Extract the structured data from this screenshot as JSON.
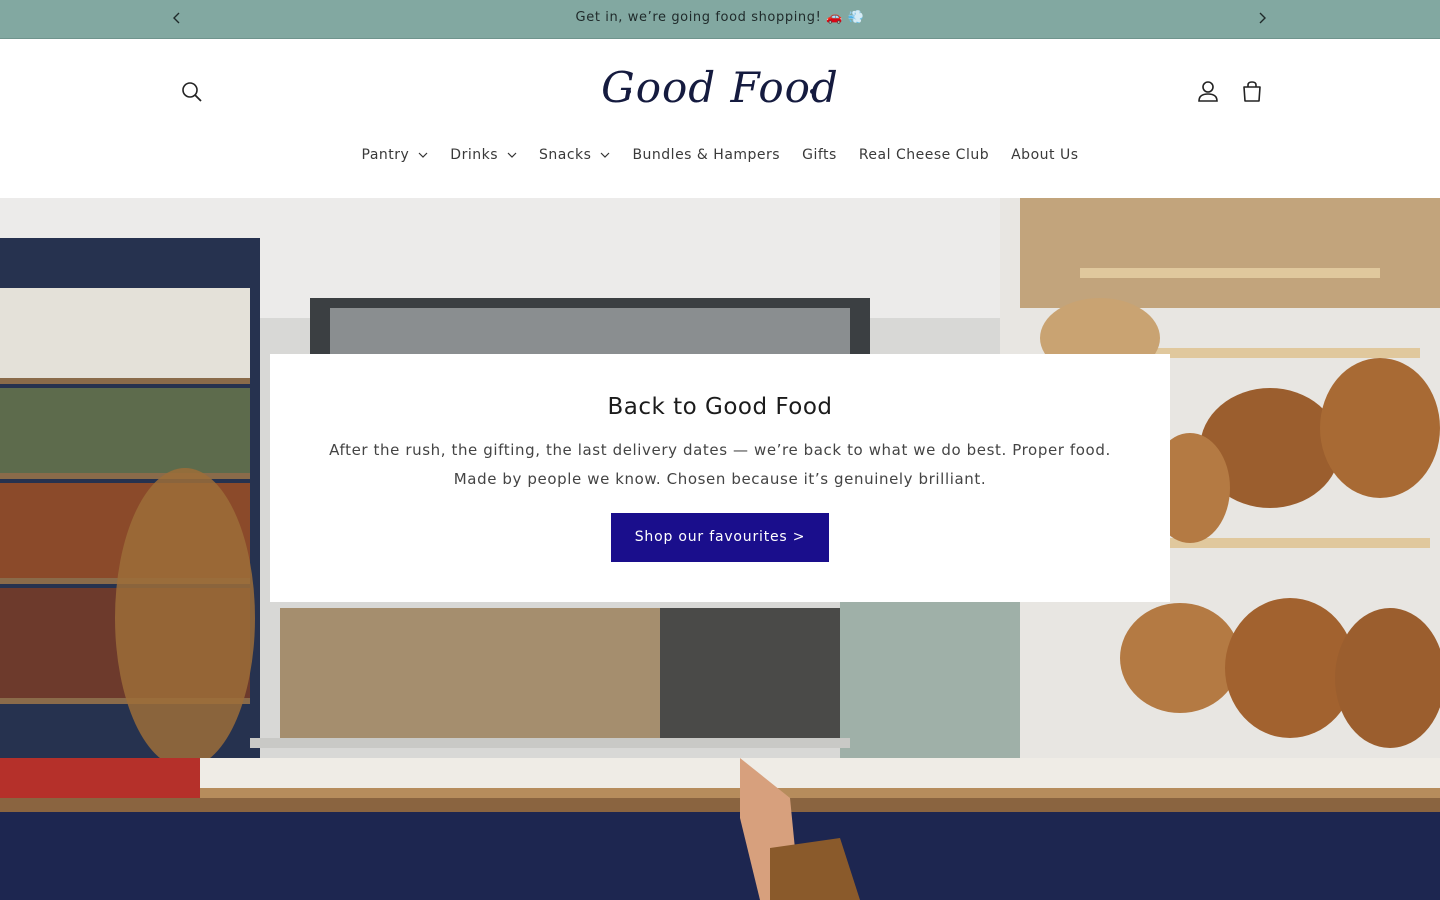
{
  "announcement": {
    "text": "Get in, we’re going food shopping! 🚗 💨",
    "prev_icon": "chevron-left-icon",
    "next_icon": "chevron-right-icon"
  },
  "header": {
    "logo_text": "Good Food",
    "icons": [
      "search-icon",
      "account-icon",
      "cart-icon"
    ]
  },
  "nav": {
    "items": [
      {
        "label": "Pantry",
        "dropdown": true
      },
      {
        "label": "Drinks",
        "dropdown": true
      },
      {
        "label": "Snacks",
        "dropdown": true
      },
      {
        "label": "Bundles & Hampers",
        "dropdown": false
      },
      {
        "label": "Gifts",
        "dropdown": false
      },
      {
        "label": "Real Cheese Club",
        "dropdown": false
      },
      {
        "label": "About Us",
        "dropdown": false
      }
    ]
  },
  "hero": {
    "title": "Back to Good Food",
    "text": "After the rush, the gifting, the last delivery dates — we’re back to what we do best. Proper food. Made by people we know. Chosen because it’s genuinely brilliant.",
    "button_label": "Shop our favourites >"
  },
  "colors": {
    "announcement_bg": "#82a8a1",
    "logo": "#151b3f",
    "button_bg": "#1a0e8c"
  }
}
